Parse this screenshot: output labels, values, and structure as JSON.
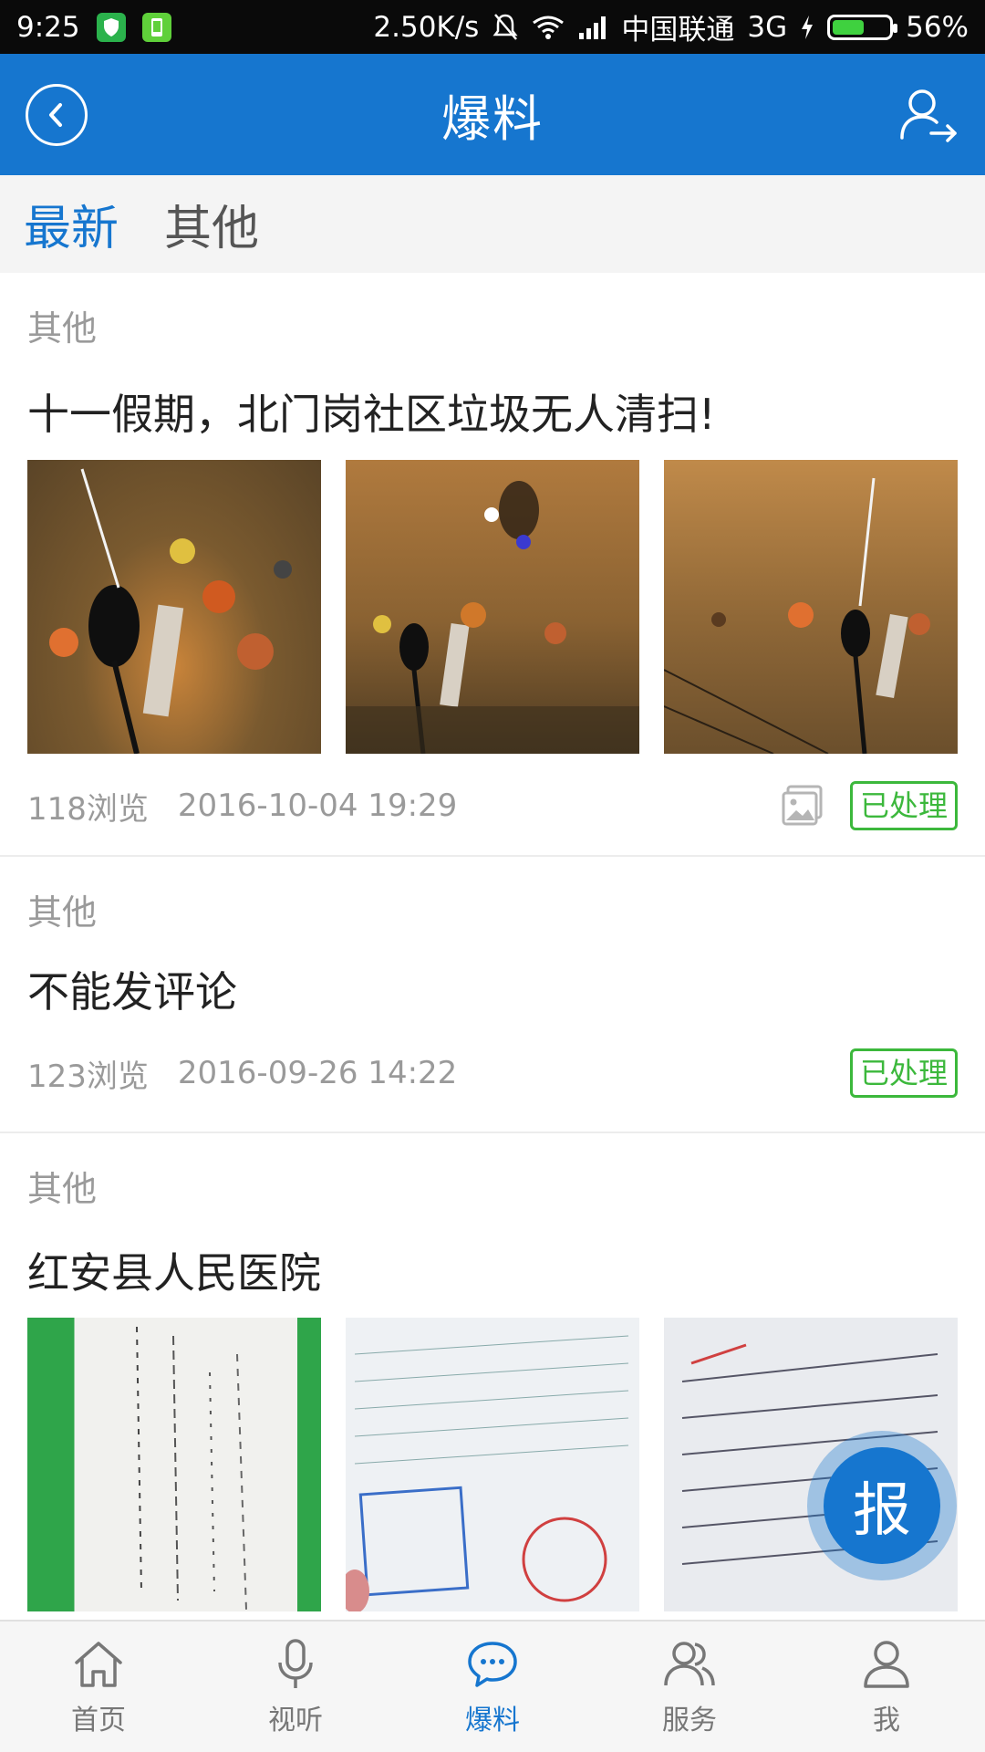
{
  "status_bar": {
    "time": "9:25",
    "net_speed": "2.50K/s",
    "carrier": "中国联通",
    "network": "3G",
    "battery_percent": "56%",
    "battery_level": 0.56
  },
  "header": {
    "title": "爆料"
  },
  "tabs": [
    {
      "label": "最新",
      "active": true
    },
    {
      "label": "其他",
      "active": false
    }
  ],
  "posts": [
    {
      "category": "其他",
      "title": "十一假期，北门岗社区垃圾无人清扫!",
      "views": "118浏览",
      "datetime": "2016-10-04 19:29",
      "status": "已处理",
      "has_gallery": true
    },
    {
      "category": "其他",
      "title": "不能发评论",
      "views": "123浏览",
      "datetime": "2016-09-26 14:22",
      "status": "已处理",
      "has_gallery": false
    },
    {
      "category": "其他",
      "title": "红安县人民医院"
    }
  ],
  "fab": {
    "label": "报"
  },
  "bottom_nav": [
    {
      "label": "首页",
      "icon": "home-icon"
    },
    {
      "label": "视听",
      "icon": "microphone-icon"
    },
    {
      "label": "爆料",
      "icon": "chat-bubble-icon",
      "active": true
    },
    {
      "label": "服务",
      "icon": "users-icon"
    },
    {
      "label": "我",
      "icon": "person-icon"
    }
  ],
  "colors": {
    "primary": "#1676cf",
    "success": "#3cb83c",
    "status_bar": "#0a0a0a"
  }
}
